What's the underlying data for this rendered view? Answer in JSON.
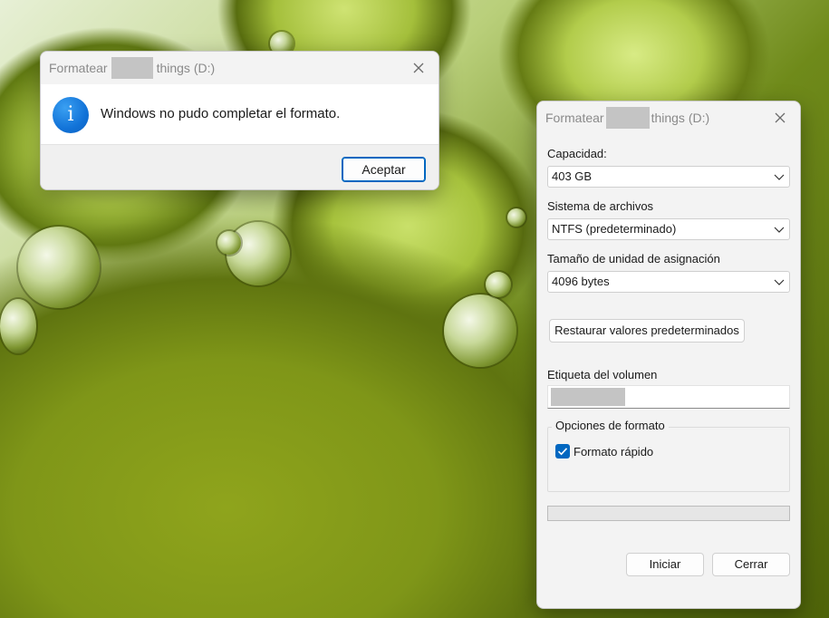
{
  "message_box": {
    "title_prefix": "Formatear",
    "title_suffix": "things (D:)",
    "message": "Windows no pudo completar el formato.",
    "ok_label": "Aceptar",
    "icon": "info-icon"
  },
  "format_dialog": {
    "title_prefix": "Formatear",
    "title_suffix": "things (D:)",
    "capacity_label": "Capacidad:",
    "capacity_value": "403 GB",
    "filesystem_label": "Sistema de archivos",
    "filesystem_value": "NTFS (predeterminado)",
    "allocation_label": "Tamaño de unidad de asignación",
    "allocation_value": "4096 bytes",
    "restore_label": "Restaurar valores predeterminados",
    "volume_label_caption": "Etiqueta del volumen",
    "options_title": "Opciones de formato",
    "quick_format_label": "Formato rápido",
    "quick_format_checked": true,
    "progress": 0,
    "start_label": "Iniciar",
    "close_label": "Cerrar"
  },
  "colors": {
    "accent": "#0067c0",
    "info_icon": "#1273d8"
  }
}
